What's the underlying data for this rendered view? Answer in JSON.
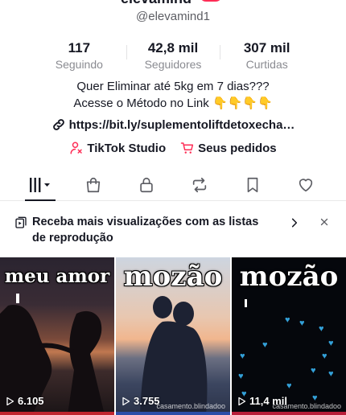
{
  "profile": {
    "name_partial": "elevamind",
    "handle": "@elevamind1",
    "stats": [
      {
        "value": "117",
        "label": "Seguindo"
      },
      {
        "value": "42,8 mil",
        "label": "Seguidores"
      },
      {
        "value": "307 mil",
        "label": "Curtidas"
      }
    ],
    "bio_line1": "Quer Eliminar até 5kg em 7 dias???",
    "bio_line2": "Acesse o Método no Link 👇👇👇👇",
    "link": "https://bit.ly/suplementoliftdetoxecha…",
    "actions": {
      "studio": "TikTok Studio",
      "orders": "Seus pedidos"
    }
  },
  "tabs": [
    {
      "name": "videos",
      "icon": "grid-bars-icon",
      "active": true
    },
    {
      "name": "shop",
      "icon": "shopping-bag-icon",
      "active": false
    },
    {
      "name": "private",
      "icon": "lock-icon",
      "active": false
    },
    {
      "name": "reposts",
      "icon": "repost-icon",
      "active": false
    },
    {
      "name": "favorites",
      "icon": "bookmark-icon",
      "active": false
    },
    {
      "name": "liked",
      "icon": "heart-icon",
      "active": false
    }
  ],
  "promo": {
    "text": "Receba mais visualizações com as listas de reprodução"
  },
  "videos": [
    {
      "title": "meu amor",
      "views": "6.105",
      "watermark": ""
    },
    {
      "title": "mozão",
      "views": "3.755",
      "watermark": "casamento.blindadoo"
    },
    {
      "title": "mozão",
      "views": "11,4 mil",
      "watermark": "casamento.blindadoo"
    }
  ],
  "colors": {
    "accent": "#fe2c55",
    "text": "#161823",
    "muted": "#8a8b91"
  }
}
